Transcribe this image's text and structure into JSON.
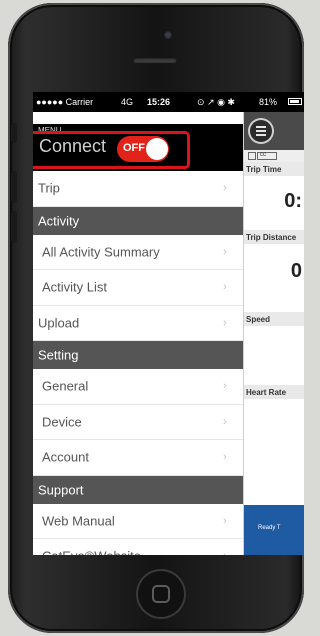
{
  "status_bar": {
    "carrier": "●●●●● Carrier",
    "network": "4G",
    "time": "15:26",
    "icons": "⊙ ↗ ◉ ✱",
    "battery": "81%"
  },
  "menu": {
    "caption": "MENU",
    "connect_label": "Connect",
    "connect_toggle": "OFF",
    "rows": [
      {
        "type": "item",
        "label": "Trip",
        "indent": false
      },
      {
        "type": "header",
        "label": "Activity"
      },
      {
        "type": "item",
        "label": "All Activity Summary",
        "indent": true
      },
      {
        "type": "item",
        "label": "Activity List",
        "indent": true
      },
      {
        "type": "item",
        "label": "Upload",
        "indent": false
      },
      {
        "type": "header",
        "label": "Setting"
      },
      {
        "type": "item",
        "label": "General",
        "indent": true
      },
      {
        "type": "item",
        "label": "Device",
        "indent": true
      },
      {
        "type": "item",
        "label": "Account",
        "indent": true
      },
      {
        "type": "header",
        "label": "Support"
      },
      {
        "type": "item",
        "label": "Web Manual",
        "indent": true
      },
      {
        "type": "item",
        "label": "CatEye®Website",
        "indent": true
      }
    ],
    "chevron": "›"
  },
  "content": {
    "tab_label": "cc",
    "trip_time_label": "Trip Time",
    "trip_time_value": "0:",
    "trip_distance_label": "Trip Distance",
    "trip_distance_value": "0",
    "speed_label": "Speed",
    "heart_rate_label": "Heart Rate",
    "banner_text": "Ready T"
  },
  "colors": {
    "highlight": "#d8141c",
    "toggle": "#e2231a",
    "section_header": "#555555",
    "banner": "#1e5ba3"
  }
}
